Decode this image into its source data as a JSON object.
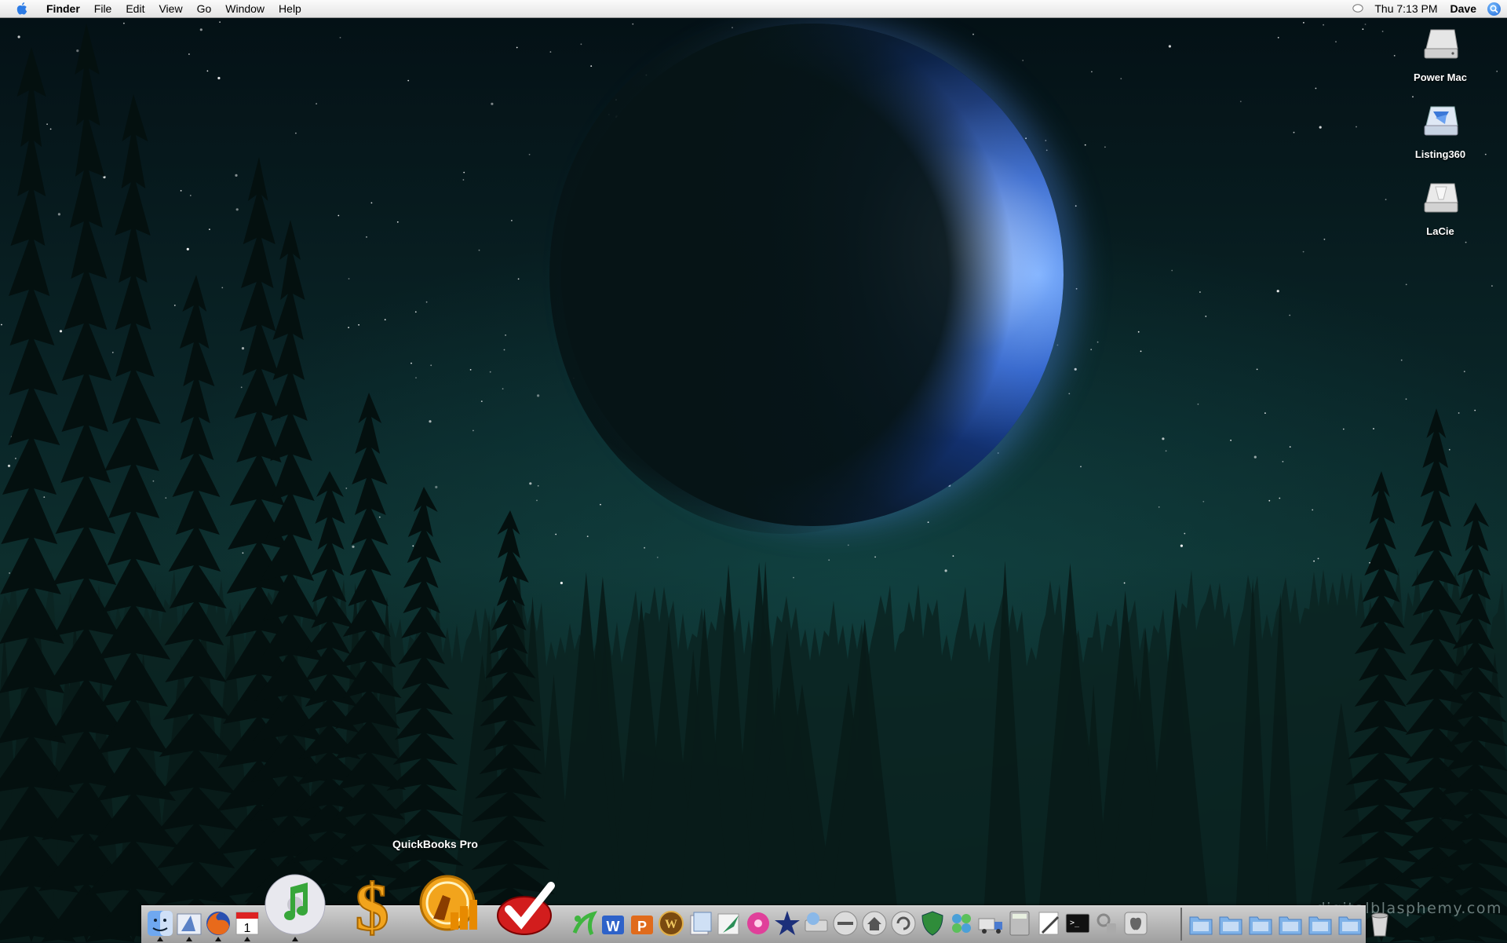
{
  "menubar": {
    "app_name": "Finder",
    "items": [
      "File",
      "Edit",
      "View",
      "Go",
      "Window",
      "Help"
    ],
    "clock": "Thu 7:13 PM",
    "user": "Dave"
  },
  "desktop_icons": [
    {
      "label": "Power Mac",
      "icon": "hard-drive-icon"
    },
    {
      "label": "Listing360",
      "icon": "disk-image-icon"
    },
    {
      "label": "LaCie",
      "icon": "external-drive-icon"
    }
  ],
  "dock": {
    "hover_label": "QuickBooks Pro",
    "apps": [
      {
        "name": "finder-icon"
      },
      {
        "name": "mail-icon"
      },
      {
        "name": "firefox-icon"
      },
      {
        "name": "ical-icon",
        "text": "1"
      },
      {
        "name": "itunes-icon"
      },
      {
        "name": "dollar-icon"
      },
      {
        "name": "quickbooks-icon"
      },
      {
        "name": "checkmark-icon"
      },
      {
        "name": "xsan-icon"
      },
      {
        "name": "word-icon",
        "text": "W"
      },
      {
        "name": "powerpoint-icon",
        "text": "P"
      },
      {
        "name": "warcraft-icon",
        "text": "W"
      },
      {
        "name": "preview-icon"
      },
      {
        "name": "quill-icon"
      },
      {
        "name": "flower-icon"
      },
      {
        "name": "star-icon"
      },
      {
        "name": "disk-utility-icon"
      },
      {
        "name": "minus-icon"
      },
      {
        "name": "home-icon"
      },
      {
        "name": "sync-icon"
      },
      {
        "name": "shield-icon"
      },
      {
        "name": "puzzle-icon"
      },
      {
        "name": "truck-icon"
      },
      {
        "name": "calculator-icon"
      },
      {
        "name": "textedit-icon"
      },
      {
        "name": "terminal-icon"
      },
      {
        "name": "keychain-icon"
      },
      {
        "name": "apple-icon"
      }
    ],
    "stacks": [
      {
        "name": "stack-system-icon"
      },
      {
        "name": "stack-documents-icon"
      },
      {
        "name": "stack-folder-icon"
      },
      {
        "name": "stack-downloads-icon"
      },
      {
        "name": "stack-applications-icon"
      },
      {
        "name": "stack-cubes-icon"
      },
      {
        "name": "trash-icon"
      }
    ]
  },
  "watermark": "digitalblasphemy.com",
  "colors": {
    "sky": "#0a2628",
    "planet": "#2b5fc9",
    "menubar": "#f0f0f0",
    "dock": "#b8b8b8"
  }
}
